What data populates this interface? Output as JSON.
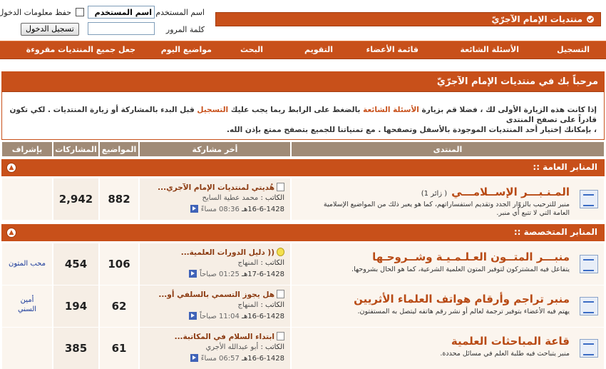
{
  "header": {
    "forum_title": "منتديات الإمام الآجرّيّ",
    "login": {
      "username_label": "اسم المستخدم",
      "username_value": "اسم المستخدم",
      "remember_label": "حفظ معلومات الدخول",
      "password_label": "كلمة المرور",
      "login_button": "تسجيل الدخول"
    }
  },
  "navbar": {
    "items": [
      "التسجيل",
      "الأسئلة الشائعة",
      "قائمة الأعضاء",
      "التقويم",
      "البحث",
      "مواضيع اليوم",
      "جعل جميع المنتديات مقروءة"
    ]
  },
  "welcome": {
    "title": "مرحباً بك في منتديات الإمام الآجرّيّ",
    "line1_a": "إذا كانت هذه الزيارة الأولى لك ، فضلا قم بزيارة",
    "line1_faq": "الأسئلة الشائعة",
    "line1_b": "بالضغط على الرابط ربما يجب عليك",
    "line1_reg": "التسجيل",
    "line1_c": "قبل البدء بالمشاركة أو زيارة المنتديات . لكي تكون قادراً على تصفح المنتدى",
    "line2": "، بإمكانك إختيار أحد المنتديات الموجودة بالأسفل وتصفحها . مع تمنياتنا للجميع بتصفح ممتع بإذن الله."
  },
  "columns": {
    "forum": "المنتدى",
    "last_post": "أخر مشاركة",
    "threads": "المواضيع",
    "posts": "المشاركات",
    "moderator": "بإشراف"
  },
  "categories": [
    {
      "name": "المنابر العامة ::",
      "forums": [
        {
          "name": "المـنـبـــر الإســلامـــي",
          "visitors": "( زائر 1)",
          "desc": "منبر للترحيب بالزوّار الجدد وتقديم استفساراتهم، كما هو يعبر ذلك من المواضيع الإسلامية العامة التي لا تتبع أي منبر.",
          "last_title": "هُديتي لمنتديات الإمام الآجري...",
          "author_label": "الكاتب :",
          "author": "محمد عطية السايح",
          "date": "16-6-1428هـ",
          "time": "08:36 مساءً",
          "threads": "882",
          "posts": "2,942",
          "moderator": ""
        }
      ]
    },
    {
      "name": "المنابر المتخصصة ::",
      "forums": [
        {
          "name": "منبـــر المتــون العـلـمـيـة وشــروحـها",
          "visitors": "",
          "desc": "يتفاعل فيه المشتركون لتوفير المتون العلمية الشرعية، كما هو الحال بشروحها.",
          "last_title": "(( دليل الدورات العلمية...",
          "author_label": "الكاتب :",
          "author": "المنهاج",
          "date": "17-6-1428هـ",
          "time": "01:25 صباحاً",
          "threads": "106",
          "posts": "454",
          "moderator": "محب المتون"
        },
        {
          "name": "منبر تراجم وأرقام هواتف العلماء الأثريين",
          "visitors": "",
          "desc": "يهتم فيه الأعضاء بتوفير ترجمة لعالم أو نشر رقم هاتفه ليتصل به المستفتون.",
          "last_title": "هل يجوز التسمي بالسلفي أو...",
          "author_label": "الكاتب :",
          "author": "المنهاج",
          "date": "16-6-1428هـ",
          "time": "11:04 صباحاً",
          "threads": "62",
          "posts": "194",
          "moderator": "أمين السني"
        },
        {
          "name": "قاعة المباحثات العلمية",
          "visitors": "",
          "desc": "منبر يتباحث فيه طلبة العلم في مسائل محددة.",
          "last_title": "ابتداء السلام في المكاتبة...",
          "author_label": "الكاتب :",
          "author": "أبو عبدالله الأجري",
          "date": "16-6-1428هـ",
          "time": "06:57 مساءً",
          "threads": "61",
          "posts": "385",
          "moderator": ""
        }
      ]
    }
  ]
}
